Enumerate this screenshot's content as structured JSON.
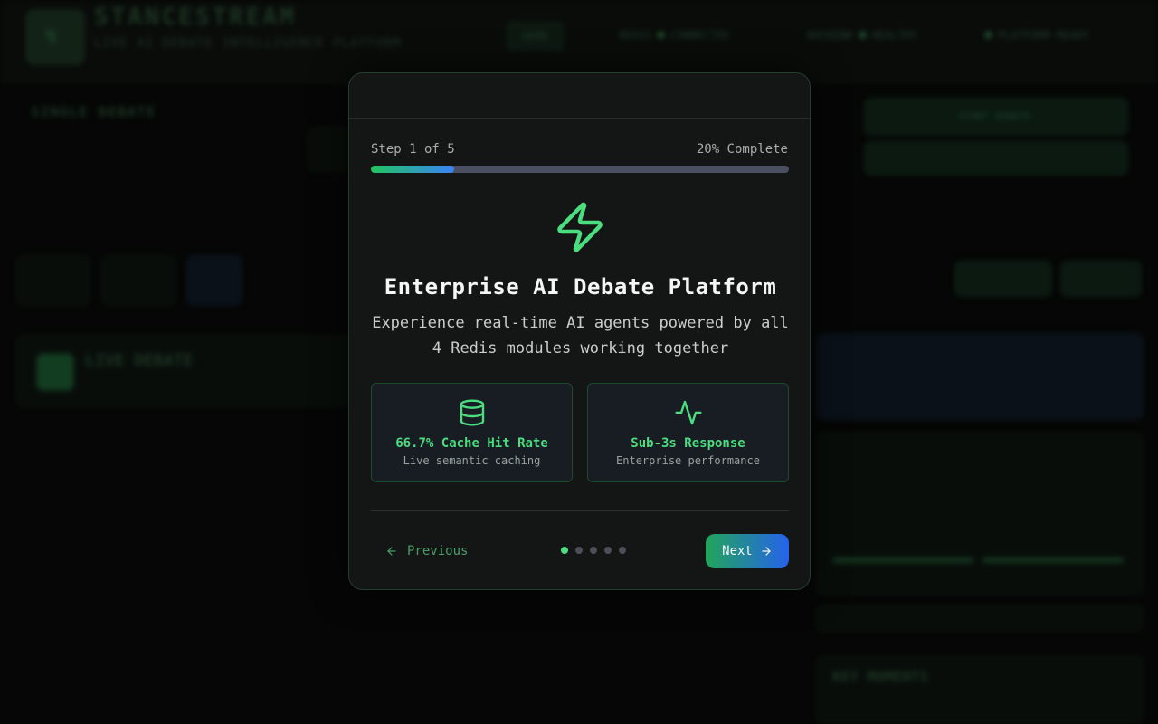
{
  "modal": {
    "step_label": "Step 1 of 5",
    "percent_label": "20% Complete",
    "progress_fraction": 0.2,
    "icon": "zap-icon",
    "title": "Enterprise AI Debate Platform",
    "description": "Experience real-time AI agents powered by all 4 Redis modules working together",
    "features": [
      {
        "icon": "database-icon",
        "title": "66.7% Cache Hit Rate",
        "subtitle": "Live semantic caching"
      },
      {
        "icon": "activity-icon",
        "title": "Sub-3s Response",
        "subtitle": "Enterprise performance"
      }
    ],
    "previous_label": "Previous",
    "next_label": "Next",
    "total_steps": 5,
    "current_step": 1
  },
  "background": {
    "brand": "STANCESTREAM",
    "brand_sub": "LIVE AI DEBATE INTELLIGENCE PLATFORM",
    "nav": [
      "DEMO",
      "REDIS",
      "CONNECTED",
      "BACKEND",
      "HEALTHY",
      "PLATFORM READY"
    ],
    "section_title": "SINGLE DEBATE",
    "live_title": "LIVE DEBATE",
    "start_button": "START DEBATE",
    "key_moments": "KEY MOMENTS"
  },
  "colors": {
    "accent": "#4ade80",
    "progress_start": "#22c55e",
    "progress_end": "#3b82f6",
    "modal_bg": "#141515"
  }
}
